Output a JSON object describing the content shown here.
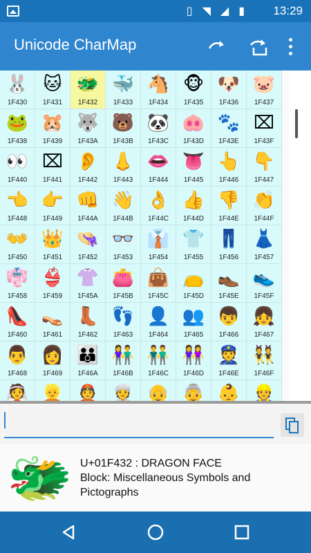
{
  "statusbar": {
    "time": "13:29",
    "icons": [
      "image-icon",
      "vibrate-icon",
      "wifi-icon",
      "signal-icon",
      "battery-icon"
    ]
  },
  "appbar": {
    "title": "Unicode CharMap",
    "actions": [
      "redo-icon",
      "send-icon",
      "overflow-menu-icon"
    ]
  },
  "grid": {
    "rows": [
      [
        {
          "g": "🐰",
          "c": "1F430"
        },
        {
          "g": "🐱",
          "c": "1F431"
        },
        {
          "g": "🐲",
          "c": "1F432",
          "selected": true
        },
        {
          "g": "🐳",
          "c": "1F433"
        },
        {
          "g": "🐴",
          "c": "1F434"
        },
        {
          "g": "🐵",
          "c": "1F435"
        },
        {
          "g": "🐶",
          "c": "1F436"
        },
        {
          "g": "🐷",
          "c": "1F437"
        }
      ],
      [
        {
          "g": "🐸",
          "c": "1F438"
        },
        {
          "g": "🐹",
          "c": "1F439"
        },
        {
          "g": "🐺",
          "c": "1F43A"
        },
        {
          "g": "🐻",
          "c": "1F43B"
        },
        {
          "g": "🐼",
          "c": "1F43C"
        },
        {
          "g": "🐽",
          "c": "1F43D"
        },
        {
          "g": "🐾",
          "c": "1F43E"
        },
        {
          "g": "⌧",
          "c": "1F43F"
        }
      ],
      [
        {
          "g": "👀",
          "c": "1F440"
        },
        {
          "g": "⌧",
          "c": "1F441"
        },
        {
          "g": "👂",
          "c": "1F442"
        },
        {
          "g": "👃",
          "c": "1F443"
        },
        {
          "g": "👄",
          "c": "1F444"
        },
        {
          "g": "👅",
          "c": "1F445"
        },
        {
          "g": "👆",
          "c": "1F446"
        },
        {
          "g": "👇",
          "c": "1F447"
        }
      ],
      [
        {
          "g": "👈",
          "c": "1F448"
        },
        {
          "g": "👉",
          "c": "1F449"
        },
        {
          "g": "👊",
          "c": "1F44A"
        },
        {
          "g": "👋",
          "c": "1F44B"
        },
        {
          "g": "👌",
          "c": "1F44C"
        },
        {
          "g": "👍",
          "c": "1F44D"
        },
        {
          "g": "👎",
          "c": "1F44E"
        },
        {
          "g": "👏",
          "c": "1F44F"
        }
      ],
      [
        {
          "g": "👐",
          "c": "1F450"
        },
        {
          "g": "👑",
          "c": "1F451"
        },
        {
          "g": "👒",
          "c": "1F452"
        },
        {
          "g": "👓",
          "c": "1F453"
        },
        {
          "g": "👔",
          "c": "1F454"
        },
        {
          "g": "👕",
          "c": "1F455"
        },
        {
          "g": "👖",
          "c": "1F456"
        },
        {
          "g": "👗",
          "c": "1F457"
        }
      ],
      [
        {
          "g": "👘",
          "c": "1F458"
        },
        {
          "g": "👙",
          "c": "1F459"
        },
        {
          "g": "👚",
          "c": "1F45A"
        },
        {
          "g": "👛",
          "c": "1F45B"
        },
        {
          "g": "👜",
          "c": "1F45C"
        },
        {
          "g": "👝",
          "c": "1F45D"
        },
        {
          "g": "👞",
          "c": "1F45E"
        },
        {
          "g": "👟",
          "c": "1F45F"
        }
      ],
      [
        {
          "g": "👠",
          "c": "1F460"
        },
        {
          "g": "👡",
          "c": "1F461"
        },
        {
          "g": "👢",
          "c": "1F462"
        },
        {
          "g": "👣",
          "c": "1F463"
        },
        {
          "g": "👤",
          "c": "1F464"
        },
        {
          "g": "👥",
          "c": "1F465"
        },
        {
          "g": "👦",
          "c": "1F466"
        },
        {
          "g": "👧",
          "c": "1F467"
        }
      ],
      [
        {
          "g": "👨",
          "c": "1F468"
        },
        {
          "g": "👩",
          "c": "1F469"
        },
        {
          "g": "👪",
          "c": "1F46A"
        },
        {
          "g": "👫",
          "c": "1F46B"
        },
        {
          "g": "👬",
          "c": "1F46C"
        },
        {
          "g": "👭",
          "c": "1F46D"
        },
        {
          "g": "👮",
          "c": "1F46E"
        },
        {
          "g": "👯",
          "c": "1F46F"
        }
      ],
      [
        {
          "g": "👰",
          "c": ""
        },
        {
          "g": "👱",
          "c": ""
        },
        {
          "g": "👲",
          "c": ""
        },
        {
          "g": "👳",
          "c": ""
        },
        {
          "g": "👴",
          "c": ""
        },
        {
          "g": "👵",
          "c": ""
        },
        {
          "g": "👶",
          "c": ""
        },
        {
          "g": "👷",
          "c": ""
        }
      ]
    ]
  },
  "input": {
    "value": "",
    "copy_icon": "copy-icon"
  },
  "info": {
    "glyph": "🐲",
    "line1": "U+01F432 : DRAGON FACE",
    "line2": "Block: Miscellaneous Symbols and Pictographs"
  },
  "navbar": {
    "buttons": [
      "back-icon",
      "home-icon",
      "recents-icon"
    ]
  },
  "colors": {
    "statusbar": "#1a73b8",
    "appbar": "#2f86cf",
    "cell": "#d8fafa",
    "selected": "#f7f7a0",
    "navbar": "#1a6fb0"
  }
}
